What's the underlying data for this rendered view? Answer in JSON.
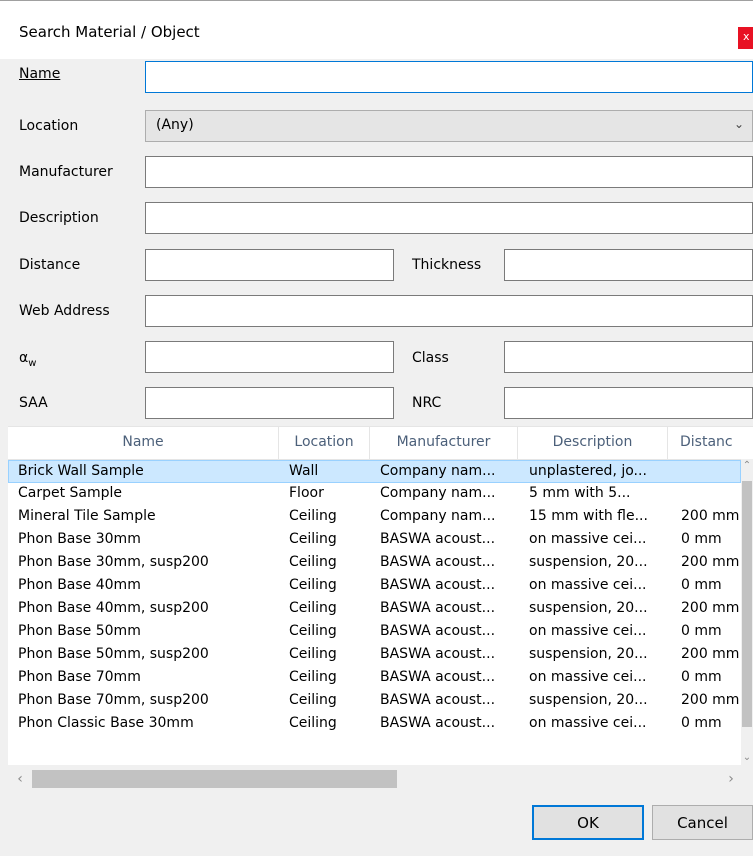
{
  "dialog": {
    "title": "Search Material / Object",
    "close_label": "x"
  },
  "form": {
    "name_label": "Name",
    "location_label": "Location",
    "location_value": "(Any)",
    "manufacturer_label": "Manufacturer",
    "description_label": "Description",
    "distance_label": "Distance",
    "thickness_label": "Thickness",
    "web_address_label": "Web Address",
    "alpha_label": "α",
    "alpha_sub": "w",
    "class_label": "Class",
    "saa_label": "SAA",
    "nrc_label": "NRC",
    "name_value": "",
    "manufacturer_value": "",
    "description_value": "",
    "distance_value": "",
    "thickness_value": "",
    "web_address_value": "",
    "alpha_value": "",
    "class_value": "",
    "saa_value": "",
    "nrc_value": ""
  },
  "table": {
    "columns": [
      "Name",
      "Location",
      "Manufacturer",
      "Description",
      "Distanc"
    ],
    "rows": [
      {
        "name": "Brick Wall Sample",
        "location": "Wall",
        "manufacturer": "Company nam...",
        "description": "unplastered, jo...",
        "distance": ""
      },
      {
        "name": "Carpet Sample",
        "location": "Floor",
        "manufacturer": "Company nam...",
        "description": "5 mm with 5...",
        "distance": ""
      },
      {
        "name": "Mineral Tile Sample",
        "location": "Ceiling",
        "manufacturer": "Company nam...",
        "description": "15 mm with fle...",
        "distance": "200 mm"
      },
      {
        "name": "Phon Base 30mm",
        "location": "Ceiling",
        "manufacturer": "BASWA acoust...",
        "description": "on massive cei...",
        "distance": "0 mm"
      },
      {
        "name": "Phon Base 30mm, susp200",
        "location": "Ceiling",
        "manufacturer": "BASWA acoust...",
        "description": "suspension, 20...",
        "distance": "200 mm"
      },
      {
        "name": "Phon Base 40mm",
        "location": "Ceiling",
        "manufacturer": "BASWA acoust...",
        "description": "on massive cei...",
        "distance": "0 mm"
      },
      {
        "name": "Phon Base 40mm, susp200",
        "location": "Ceiling",
        "manufacturer": "BASWA acoust...",
        "description": "suspension, 20...",
        "distance": "200 mm"
      },
      {
        "name": "Phon Base 50mm",
        "location": "Ceiling",
        "manufacturer": "BASWA acoust...",
        "description": "on massive cei...",
        "distance": "0 mm"
      },
      {
        "name": "Phon Base 50mm, susp200",
        "location": "Ceiling",
        "manufacturer": "BASWA acoust...",
        "description": "suspension, 20...",
        "distance": "200 mm"
      },
      {
        "name": "Phon Base 70mm",
        "location": "Ceiling",
        "manufacturer": "BASWA acoust...",
        "description": "on massive cei...",
        "distance": "0 mm"
      },
      {
        "name": "Phon Base 70mm, susp200",
        "location": "Ceiling",
        "manufacturer": "BASWA acoust...",
        "description": "suspension, 20...",
        "distance": "200 mm"
      },
      {
        "name": "Phon Classic Base 30mm",
        "location": "Ceiling",
        "manufacturer": "BASWA acoust...",
        "description": "on massive cei...",
        "distance": "0 mm"
      }
    ]
  },
  "buttons": {
    "ok": "OK",
    "cancel": "Cancel"
  },
  "colors": {
    "accent": "#0078d7",
    "selection": "#cce8ff",
    "close": "#e81123",
    "header_text": "#4c607a"
  },
  "icons": {
    "combo": "chevron-down-icon",
    "close": "close-icon"
  }
}
